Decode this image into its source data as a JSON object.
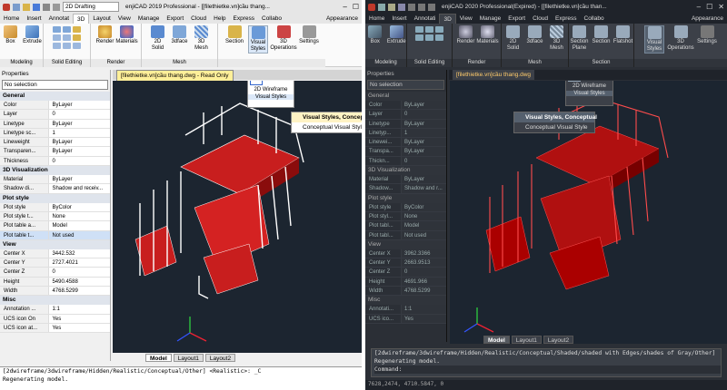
{
  "left": {
    "workspace": "2D Drafting",
    "title": "enjiCAD 2019 Professional - [[filethietke.vn]cầu thang...",
    "tabs": [
      "Home",
      "Insert",
      "Annotat",
      "3D",
      "Layout",
      "View",
      "Manage",
      "Export",
      "Cloud",
      "Help",
      "Express",
      "Collabo"
    ],
    "active_tab": "3D",
    "appearance": "Appearance",
    "panels": [
      {
        "label": "Modeling",
        "buttons": [
          "Box",
          "Extrude"
        ]
      },
      {
        "label": "Solid Editing",
        "buttons": []
      },
      {
        "label": "Render",
        "buttons": [
          "Render",
          "Materials"
        ]
      },
      {
        "label": "Mesh",
        "buttons": [
          "2D Solid",
          "3dface",
          "3D Mesh"
        ]
      },
      {
        "label": "",
        "buttons": [
          "Section",
          "Visual Styles",
          "3D Operations",
          "Settings"
        ]
      }
    ],
    "doc_tab": "[filethietke.vn]cầu thang.dwg - Read Only",
    "props_title": "Properties",
    "selection": "No selection",
    "sections": [
      {
        "name": "General",
        "rows": [
          [
            "Color",
            "ByLayer"
          ],
          [
            "Layer",
            "0"
          ],
          [
            "Linetype",
            "ByLayer"
          ],
          [
            "Linetype sc...",
            "1"
          ],
          [
            "Lineweight",
            "ByLayer"
          ],
          [
            "Transparen...",
            "ByLayer"
          ],
          [
            "Thickness",
            "0"
          ]
        ]
      },
      {
        "name": "3D Visualization",
        "rows": [
          [
            "Material",
            "ByLayer"
          ],
          [
            "Shadow di...",
            "Shadow and receiv..."
          ]
        ]
      },
      {
        "name": "Plot style",
        "rows": [
          [
            "Plot style",
            "ByColor"
          ],
          [
            "Plot style t...",
            "None"
          ],
          [
            "Plot table a...",
            "Model"
          ],
          [
            "Plot table t...",
            "Not used"
          ]
        ]
      },
      {
        "name": "View",
        "rows": [
          [
            "Center X",
            "3442.532"
          ],
          [
            "Center Y",
            "2727.4021"
          ],
          [
            "Center Z",
            "0"
          ],
          [
            "Height",
            "5490.4588"
          ],
          [
            "Width",
            "4768.5299"
          ]
        ]
      },
      {
        "name": "Misc",
        "rows": [
          [
            "Annotation ...",
            "1:1"
          ],
          [
            "UCS icon On",
            "Yes"
          ],
          [
            "UCS icon at...",
            "Yes"
          ]
        ]
      }
    ],
    "popup": {
      "wireframe": "2D Wireframe",
      "panel_label": "Visual Styles"
    },
    "menu": [
      "Visual Styles, Conceptual",
      "Conceptual Visual Style"
    ],
    "layout_tabs": [
      "Model",
      "Layout1",
      "Layout2"
    ],
    "command_lines": [
      "[2dwireframe/3dwireframe/Hidden/Realistic/Conceptual/Other] <Realistic>: _C",
      "Regenerating model."
    ]
  },
  "right": {
    "title": "enjiCAD 2020 Professional(Expired) - [[filethietke.vn]cầu than...",
    "tabs": [
      "Home",
      "Insert",
      "Annotati",
      "3D",
      "View",
      "Manage",
      "Export",
      "Cloud",
      "Express",
      "Collabo"
    ],
    "active_tab": "3D",
    "appearance": "Appearance",
    "panels": [
      {
        "label": "Modeling",
        "buttons": [
          "Box",
          "Extrude"
        ]
      },
      {
        "label": "Solid Editing",
        "buttons": []
      },
      {
        "label": "Render",
        "buttons": [
          "Render",
          "Materials"
        ]
      },
      {
        "label": "Mesh",
        "buttons": [
          "2D Solid",
          "3dface",
          "3D Mesh"
        ]
      },
      {
        "label": "Section",
        "buttons": [
          "Section Plane",
          "Section",
          "Flatshot"
        ]
      },
      {
        "label": "",
        "buttons": [
          "Visual Styles",
          "3D Operations",
          "Settings"
        ]
      }
    ],
    "doc_tab": "[filethietke.vn]cầu thang.dwg",
    "props_title": "Properties",
    "selection": "No selection",
    "sections": [
      {
        "name": "General",
        "rows": [
          [
            "Color",
            "ByLayer"
          ],
          [
            "Layer",
            "0"
          ],
          [
            "Linetype",
            "ByLayer"
          ],
          [
            "Linetyp...",
            "1"
          ],
          [
            "Linewei...",
            "ByLayer"
          ],
          [
            "Transpa...",
            "ByLayer"
          ],
          [
            "Thickn...",
            "0"
          ]
        ]
      },
      {
        "name": "3D Visualization",
        "rows": [
          [
            "Material",
            "ByLayer"
          ],
          [
            "Shadow...",
            "Shadow and r..."
          ]
        ]
      },
      {
        "name": "Plot style",
        "rows": [
          [
            "Plot style",
            "ByColor"
          ],
          [
            "Plot styl...",
            "None"
          ],
          [
            "Plot tabl...",
            "Model"
          ],
          [
            "Plot tabl...",
            "Not used"
          ]
        ]
      },
      {
        "name": "View",
        "rows": [
          [
            "Center X",
            "3962.3366"
          ],
          [
            "Center Y",
            "2663.9513"
          ],
          [
            "Center Z",
            "0"
          ],
          [
            "Height",
            "4691.966"
          ],
          [
            "Width",
            "4768.5299"
          ]
        ]
      },
      {
        "name": "Misc",
        "rows": [
          [
            "Annotati...",
            "1:1"
          ],
          [
            "UCS ico...",
            "Yes"
          ]
        ]
      }
    ],
    "popup": {
      "wireframe": "2D Wireframe",
      "panel_label": "Visual Styles"
    },
    "menu": [
      "Visual Styles, Conceptual",
      "Conceptual Visual Style"
    ],
    "layout_tabs": [
      "Model",
      "Layout1",
      "Layout2"
    ],
    "command_lines": [
      "[2dwireframe/3dwireframe/Hidden/Realistic/Conceptual/Shaded/shaded with Edges/shades of Gray/Other]",
      "Regenerating model.",
      "Command:"
    ],
    "status_coords": "7628,2474, 4710.5847, 0"
  }
}
